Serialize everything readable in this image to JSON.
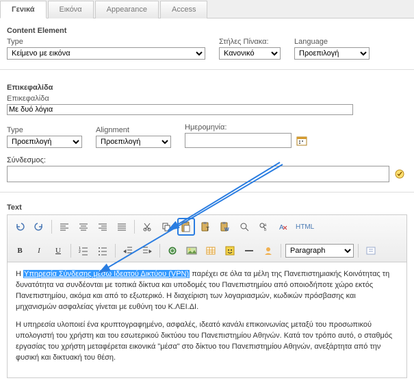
{
  "tabs": [
    {
      "label": "Γενικά",
      "active": true
    },
    {
      "label": "Εικόνα",
      "active": false
    },
    {
      "label": "Appearance",
      "active": false
    },
    {
      "label": "Access",
      "active": false
    }
  ],
  "contentElement": {
    "title": "Content Element",
    "typeLabel": "Type",
    "typeValue": "Κείμενο με εικόνα",
    "columnsLabel": "Στήλες Πίνακα:",
    "columnsValue": "Κανονικό",
    "langLabel": "Language",
    "langValue": "Προεπιλογή"
  },
  "header": {
    "title": "Επικεφαλίδα",
    "label": "Επικεφαλίδα",
    "value": "Με δυό λόγια",
    "typeLabel": "Type",
    "typeValue": "Προεπιλογή",
    "alignLabel": "Alignment",
    "alignValue": "Προεπιλογή",
    "dateLabel": "Ημερομηνία:",
    "dateValue": "",
    "linkLabel": "Σύνδεσμος:",
    "linkValue": ""
  },
  "text": {
    "title": "Text",
    "paragraphLabel": "Paragraph",
    "htmlBtn": "HTML",
    "body": {
      "p1_before": "Η ",
      "p1_link": "Υπηρεσία Σύνδεσης μέσω Ιδεατού Δικτύου (VPN)",
      "p1_after": " παρέχει σε όλα τα μέλη της Πανεπιστημιακής Κοινότητας τη δυνατότητα να συνδέονται με τοπικά δίκτυα και υποδομές του Πανεπιστημίου από οποιοδήποτε χώρο εκτός Πανεπιστημίου, ακόμα και από το εξωτερικό. Η διαχείριση των λογαριασμών, κωδικών πρόσβασης και μηχανισμών ασφαλείας γίνεται με ευθύνη του Κ.ΛΕΙ.ΔΙ.",
      "p2": "Η υπηρεσία υλοποιεί ένα κρυπτογραφημένο, ασφαλές, ιδεατό κανάλι επικοινωνίας μεταξύ του προσωπικού υπολογιστή του χρήστη και του εσωτερικού δικτύου του Πανεπιστημίου Αθηνών. Κατά τον τρόπο αυτό, ο σταθμός εργασίας του χρήστη μεταφέρεται εικονικά \"μέσα\" στο δίκτυο του Πανεπιστημίου Αθηνών, ανεξάρτητα από την φυσική και δικτυακή του θέση."
    }
  }
}
